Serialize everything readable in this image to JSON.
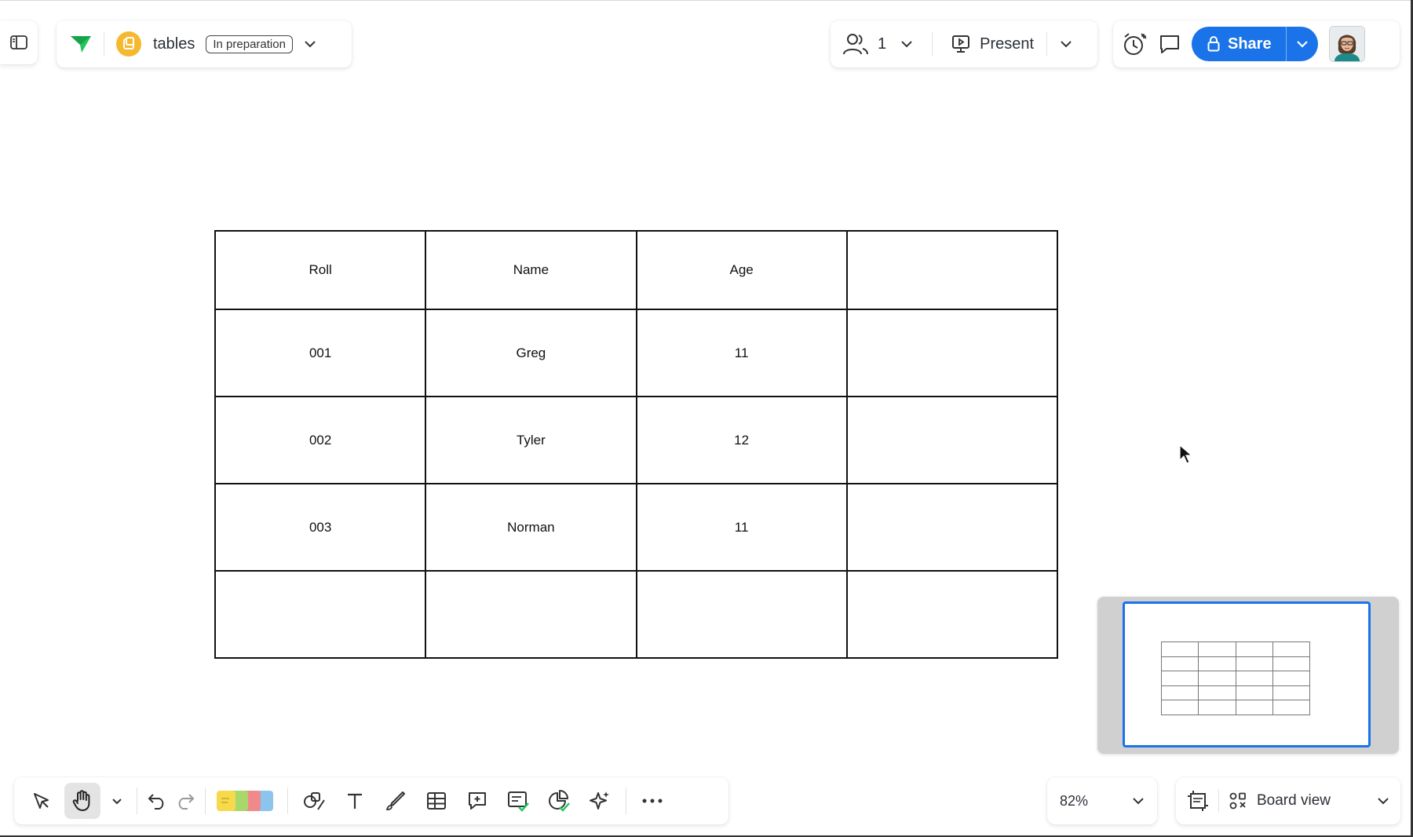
{
  "board": {
    "title": "tables",
    "status": "In preparation"
  },
  "collaboration": {
    "participant_count": "1",
    "present_label": "Present"
  },
  "actions": {
    "share_label": "Share"
  },
  "table": {
    "header": [
      "Roll",
      "Name",
      "Age",
      ""
    ],
    "rows": [
      [
        "001",
        "Greg",
        "11",
        ""
      ],
      [
        "002",
        "Tyler",
        "12",
        ""
      ],
      [
        "003",
        "Norman",
        "11",
        ""
      ],
      [
        "",
        "",
        "",
        ""
      ]
    ]
  },
  "toolbar": {
    "tools": [
      "select-icon",
      "hand-icon",
      "chevron-down-icon",
      "undo-icon",
      "redo-icon",
      "sticky-notes-icon",
      "shapes-icon",
      "text-icon",
      "pen-icon",
      "table-icon",
      "comment-icon",
      "card-icon",
      "diagram-icon",
      "ai-sparkle-icon",
      "more-icon"
    ],
    "sticky_colors": [
      "#f7d94c",
      "#a8d86b",
      "#f08a8a",
      "#8cc4ee"
    ]
  },
  "zoom": {
    "level": "82%"
  },
  "view": {
    "label": "Board view"
  },
  "colors": {
    "accent": "#1a73e8",
    "logo_green": "#22c55e",
    "board_icon": "#f5b82e"
  }
}
